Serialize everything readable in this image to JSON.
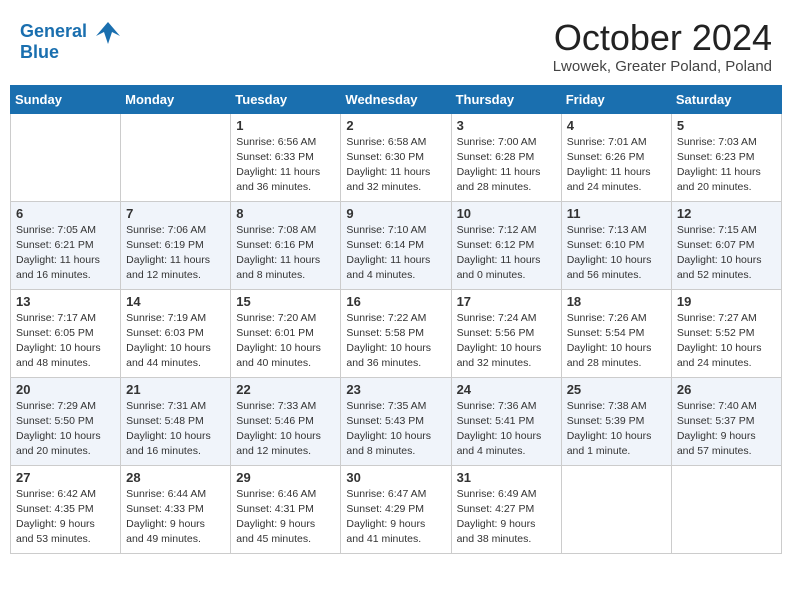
{
  "header": {
    "logo_line1": "General",
    "logo_line2": "Blue",
    "month_title": "October 2024",
    "location": "Lwowek, Greater Poland, Poland"
  },
  "weekdays": [
    "Sunday",
    "Monday",
    "Tuesday",
    "Wednesday",
    "Thursday",
    "Friday",
    "Saturday"
  ],
  "weeks": [
    [
      {
        "day": "",
        "info": ""
      },
      {
        "day": "",
        "info": ""
      },
      {
        "day": "1",
        "info": "Sunrise: 6:56 AM\nSunset: 6:33 PM\nDaylight: 11 hours and 36 minutes."
      },
      {
        "day": "2",
        "info": "Sunrise: 6:58 AM\nSunset: 6:30 PM\nDaylight: 11 hours and 32 minutes."
      },
      {
        "day": "3",
        "info": "Sunrise: 7:00 AM\nSunset: 6:28 PM\nDaylight: 11 hours and 28 minutes."
      },
      {
        "day": "4",
        "info": "Sunrise: 7:01 AM\nSunset: 6:26 PM\nDaylight: 11 hours and 24 minutes."
      },
      {
        "day": "5",
        "info": "Sunrise: 7:03 AM\nSunset: 6:23 PM\nDaylight: 11 hours and 20 minutes."
      }
    ],
    [
      {
        "day": "6",
        "info": "Sunrise: 7:05 AM\nSunset: 6:21 PM\nDaylight: 11 hours and 16 minutes."
      },
      {
        "day": "7",
        "info": "Sunrise: 7:06 AM\nSunset: 6:19 PM\nDaylight: 11 hours and 12 minutes."
      },
      {
        "day": "8",
        "info": "Sunrise: 7:08 AM\nSunset: 6:16 PM\nDaylight: 11 hours and 8 minutes."
      },
      {
        "day": "9",
        "info": "Sunrise: 7:10 AM\nSunset: 6:14 PM\nDaylight: 11 hours and 4 minutes."
      },
      {
        "day": "10",
        "info": "Sunrise: 7:12 AM\nSunset: 6:12 PM\nDaylight: 11 hours and 0 minutes."
      },
      {
        "day": "11",
        "info": "Sunrise: 7:13 AM\nSunset: 6:10 PM\nDaylight: 10 hours and 56 minutes."
      },
      {
        "day": "12",
        "info": "Sunrise: 7:15 AM\nSunset: 6:07 PM\nDaylight: 10 hours and 52 minutes."
      }
    ],
    [
      {
        "day": "13",
        "info": "Sunrise: 7:17 AM\nSunset: 6:05 PM\nDaylight: 10 hours and 48 minutes."
      },
      {
        "day": "14",
        "info": "Sunrise: 7:19 AM\nSunset: 6:03 PM\nDaylight: 10 hours and 44 minutes."
      },
      {
        "day": "15",
        "info": "Sunrise: 7:20 AM\nSunset: 6:01 PM\nDaylight: 10 hours and 40 minutes."
      },
      {
        "day": "16",
        "info": "Sunrise: 7:22 AM\nSunset: 5:58 PM\nDaylight: 10 hours and 36 minutes."
      },
      {
        "day": "17",
        "info": "Sunrise: 7:24 AM\nSunset: 5:56 PM\nDaylight: 10 hours and 32 minutes."
      },
      {
        "day": "18",
        "info": "Sunrise: 7:26 AM\nSunset: 5:54 PM\nDaylight: 10 hours and 28 minutes."
      },
      {
        "day": "19",
        "info": "Sunrise: 7:27 AM\nSunset: 5:52 PM\nDaylight: 10 hours and 24 minutes."
      }
    ],
    [
      {
        "day": "20",
        "info": "Sunrise: 7:29 AM\nSunset: 5:50 PM\nDaylight: 10 hours and 20 minutes."
      },
      {
        "day": "21",
        "info": "Sunrise: 7:31 AM\nSunset: 5:48 PM\nDaylight: 10 hours and 16 minutes."
      },
      {
        "day": "22",
        "info": "Sunrise: 7:33 AM\nSunset: 5:46 PM\nDaylight: 10 hours and 12 minutes."
      },
      {
        "day": "23",
        "info": "Sunrise: 7:35 AM\nSunset: 5:43 PM\nDaylight: 10 hours and 8 minutes."
      },
      {
        "day": "24",
        "info": "Sunrise: 7:36 AM\nSunset: 5:41 PM\nDaylight: 10 hours and 4 minutes."
      },
      {
        "day": "25",
        "info": "Sunrise: 7:38 AM\nSunset: 5:39 PM\nDaylight: 10 hours and 1 minute."
      },
      {
        "day": "26",
        "info": "Sunrise: 7:40 AM\nSunset: 5:37 PM\nDaylight: 9 hours and 57 minutes."
      }
    ],
    [
      {
        "day": "27",
        "info": "Sunrise: 6:42 AM\nSunset: 4:35 PM\nDaylight: 9 hours and 53 minutes."
      },
      {
        "day": "28",
        "info": "Sunrise: 6:44 AM\nSunset: 4:33 PM\nDaylight: 9 hours and 49 minutes."
      },
      {
        "day": "29",
        "info": "Sunrise: 6:46 AM\nSunset: 4:31 PM\nDaylight: 9 hours and 45 minutes."
      },
      {
        "day": "30",
        "info": "Sunrise: 6:47 AM\nSunset: 4:29 PM\nDaylight: 9 hours and 41 minutes."
      },
      {
        "day": "31",
        "info": "Sunrise: 6:49 AM\nSunset: 4:27 PM\nDaylight: 9 hours and 38 minutes."
      },
      {
        "day": "",
        "info": ""
      },
      {
        "day": "",
        "info": ""
      }
    ]
  ]
}
